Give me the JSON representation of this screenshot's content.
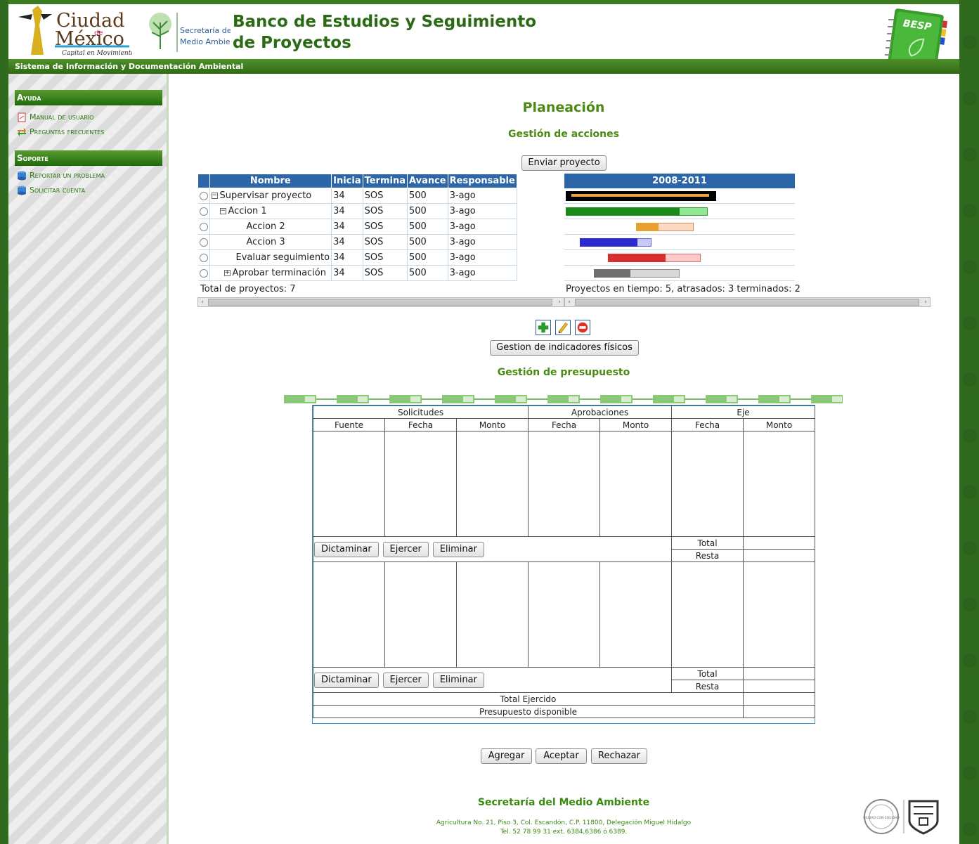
{
  "header": {
    "title": "Banco de Estudios y Seguimiento de Proyectos",
    "subtitle": "Sistema de Información y Documentación Ambiental",
    "logo_cdmx_line1": "Ciudad",
    "logo_cdmx_de": "de",
    "logo_cdmx_line2": "México",
    "logo_cdmx_tagline": "Capital en Movimiento",
    "logo_sma_line1": "Secretaría del",
    "logo_sma_line2": "Medio Ambiente",
    "besp_label": "BESP"
  },
  "sidebar": {
    "ayuda_title": "Ayuda",
    "ayuda_items": [
      "Manual de usuario",
      "Preguntas frecuentes"
    ],
    "soporte_title": "Soporte",
    "soporte_items": [
      "Reportar un problema",
      "Solicitar cuenta"
    ]
  },
  "main": {
    "title": "Planeación",
    "section_actions": "Gestión de acciones",
    "send_button": "Enviar proyecto",
    "grid_headers": [
      "Nombre",
      "Inicia",
      "Termina",
      "Avance",
      "Responsable"
    ],
    "rows": [
      {
        "nombre": "Supervisar proyecto",
        "inicia": "34",
        "termina": "SOS",
        "avance": "500",
        "responsable": "3-ago"
      },
      {
        "nombre": "Accion 1",
        "inicia": "34",
        "termina": "SOS",
        "avance": "500",
        "responsable": "3-ago"
      },
      {
        "nombre": "Accion 2",
        "inicia": "34",
        "termina": "SOS",
        "avance": "500",
        "responsable": "3-ago"
      },
      {
        "nombre": "Accion 3",
        "inicia": "34",
        "termina": "SOS",
        "avance": "500",
        "responsable": "3-ago"
      },
      {
        "nombre": "Evaluar seguimiento",
        "inicia": "34",
        "termina": "SOS",
        "avance": "500",
        "responsable": "3-ago"
      },
      {
        "nombre": "Aprobar terminación",
        "inicia": "34",
        "termina": "SOS",
        "avance": "500",
        "responsable": "3-ago"
      }
    ],
    "grid_total": "Total de proyectos: 7",
    "gantt_header": "2008-2011",
    "gantt_footer": "Proyectos en tiempo: 5, atrasados: 3 terminados: 2",
    "gantt_colors": [
      "#000000",
      "#1a8a1a",
      "#e8a030",
      "#2a2ad0",
      "#d83030",
      "#707070"
    ],
    "indicadores_button": "Gestion de indicadores físicos",
    "section_budget": "Gestión de presupuesto"
  },
  "budget": {
    "groups": [
      "Solicitudes",
      "Aprobaciones",
      "Eje"
    ],
    "columns": [
      "Fuente",
      "Fecha",
      "Monto",
      "Fecha",
      "Monto",
      "Fecha",
      "Monto"
    ],
    "buttons": [
      "Dictaminar",
      "Ejercer",
      "Eliminar"
    ],
    "total_label": "Total",
    "resta_label": "Resta",
    "total_ejercido": "Total Ejercido",
    "presupuesto_disponible": "Presupuesto disponible"
  },
  "actions": {
    "agregar": "Agregar",
    "aceptar": "Aceptar",
    "rechazar": "Rechazar"
  },
  "footer": {
    "title": "Secretaría del Medio Ambiente",
    "address_line1": "Agricultura No. 21, Piso 3, Col. Escandón, C.P. 11800, Delegación Miguel Hidalgo",
    "address_line2": "Tel. 52 78 99 31 ext. 6384,6386 ó 6389.",
    "seal_text": "CIUDAD CON EQUIDAD"
  }
}
